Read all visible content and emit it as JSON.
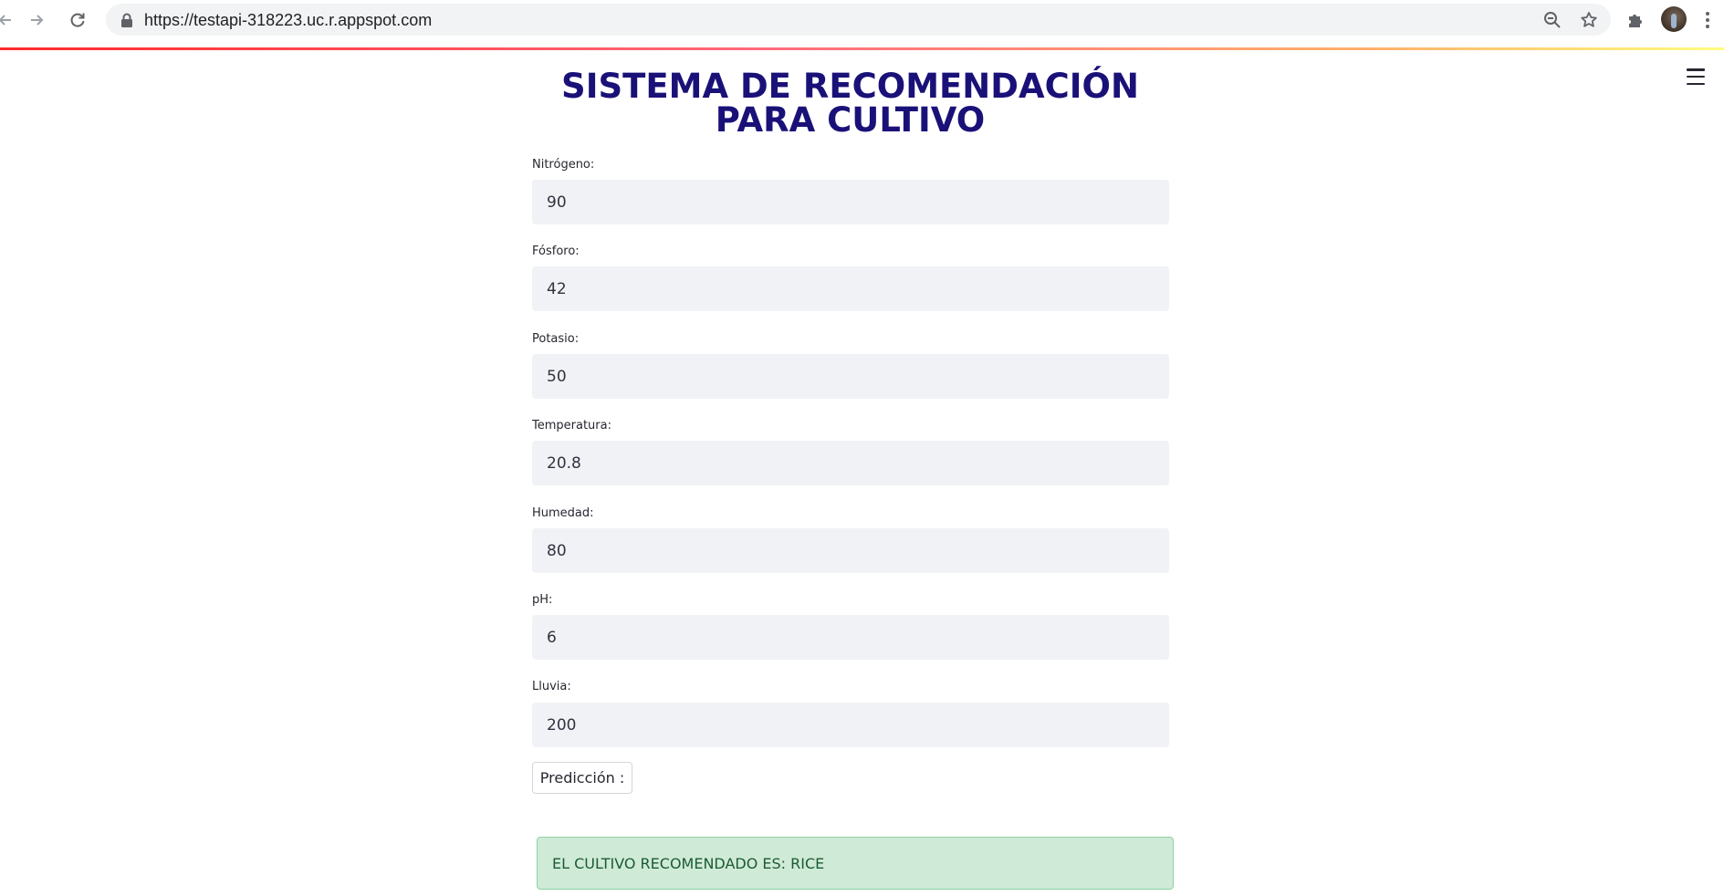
{
  "browser": {
    "url": "https://testapi-318223.uc.r.appspot.com",
    "icons": {
      "back": "arrow-left-icon",
      "forward": "arrow-right-icon",
      "reload": "reload-icon",
      "lock": "lock-icon",
      "zoom": "zoom-out-icon",
      "bookmark": "star-icon",
      "extensions": "puzzle-icon",
      "profile": "avatar",
      "menu": "kebab-menu-icon"
    }
  },
  "app": {
    "title": "SISTEMA DE RECOMENDACIÓN PARA CULTIVO",
    "menu_icon": "hamburger-menu-icon",
    "fields": [
      {
        "label": "Nitrógeno:",
        "value": "90"
      },
      {
        "label": "Fósforo:",
        "value": "42"
      },
      {
        "label": "Potasio:",
        "value": "50"
      },
      {
        "label": "Temperatura:",
        "value": "20.8"
      },
      {
        "label": "Humedad:",
        "value": "80"
      },
      {
        "label": "pH:",
        "value": "6"
      },
      {
        "label": "Lluvia:",
        "value": "200"
      }
    ],
    "predict_button": "Predicción :",
    "result_text": "EL CULTIVO RECOMENDADO ES: RICE",
    "colors": {
      "title": "#1a1178",
      "input_bg": "#f0f2f6",
      "success_bg": "#cfebd7",
      "success_text": "#1c5a34",
      "accent_bar_start": "#ff2b2b",
      "accent_bar_end": "#fffd80"
    }
  }
}
